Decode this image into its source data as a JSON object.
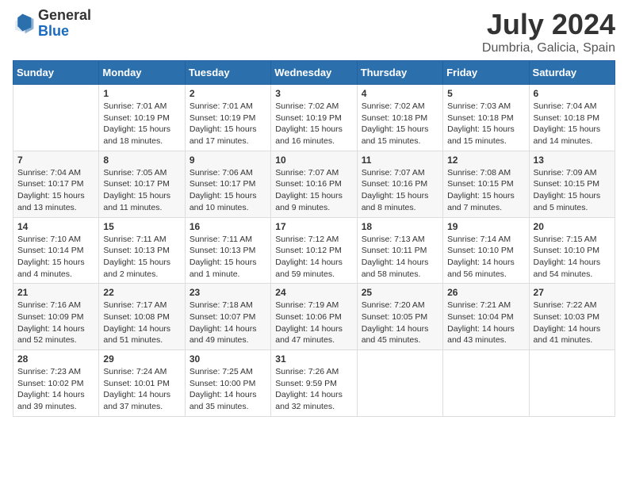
{
  "header": {
    "logo_general": "General",
    "logo_blue": "Blue",
    "month_title": "July 2024",
    "subtitle": "Dumbria, Galicia, Spain"
  },
  "weekdays": [
    "Sunday",
    "Monday",
    "Tuesday",
    "Wednesday",
    "Thursday",
    "Friday",
    "Saturday"
  ],
  "weeks": [
    [
      {
        "day": "",
        "sunrise": "",
        "sunset": "",
        "daylight": ""
      },
      {
        "day": "1",
        "sunrise": "Sunrise: 7:01 AM",
        "sunset": "Sunset: 10:19 PM",
        "daylight": "Daylight: 15 hours and 18 minutes."
      },
      {
        "day": "2",
        "sunrise": "Sunrise: 7:01 AM",
        "sunset": "Sunset: 10:19 PM",
        "daylight": "Daylight: 15 hours and 17 minutes."
      },
      {
        "day": "3",
        "sunrise": "Sunrise: 7:02 AM",
        "sunset": "Sunset: 10:19 PM",
        "daylight": "Daylight: 15 hours and 16 minutes."
      },
      {
        "day": "4",
        "sunrise": "Sunrise: 7:02 AM",
        "sunset": "Sunset: 10:18 PM",
        "daylight": "Daylight: 15 hours and 15 minutes."
      },
      {
        "day": "5",
        "sunrise": "Sunrise: 7:03 AM",
        "sunset": "Sunset: 10:18 PM",
        "daylight": "Daylight: 15 hours and 15 minutes."
      },
      {
        "day": "6",
        "sunrise": "Sunrise: 7:04 AM",
        "sunset": "Sunset: 10:18 PM",
        "daylight": "Daylight: 15 hours and 14 minutes."
      }
    ],
    [
      {
        "day": "7",
        "sunrise": "Sunrise: 7:04 AM",
        "sunset": "Sunset: 10:17 PM",
        "daylight": "Daylight: 15 hours and 13 minutes."
      },
      {
        "day": "8",
        "sunrise": "Sunrise: 7:05 AM",
        "sunset": "Sunset: 10:17 PM",
        "daylight": "Daylight: 15 hours and 11 minutes."
      },
      {
        "day": "9",
        "sunrise": "Sunrise: 7:06 AM",
        "sunset": "Sunset: 10:17 PM",
        "daylight": "Daylight: 15 hours and 10 minutes."
      },
      {
        "day": "10",
        "sunrise": "Sunrise: 7:07 AM",
        "sunset": "Sunset: 10:16 PM",
        "daylight": "Daylight: 15 hours and 9 minutes."
      },
      {
        "day": "11",
        "sunrise": "Sunrise: 7:07 AM",
        "sunset": "Sunset: 10:16 PM",
        "daylight": "Daylight: 15 hours and 8 minutes."
      },
      {
        "day": "12",
        "sunrise": "Sunrise: 7:08 AM",
        "sunset": "Sunset: 10:15 PM",
        "daylight": "Daylight: 15 hours and 7 minutes."
      },
      {
        "day": "13",
        "sunrise": "Sunrise: 7:09 AM",
        "sunset": "Sunset: 10:15 PM",
        "daylight": "Daylight: 15 hours and 5 minutes."
      }
    ],
    [
      {
        "day": "14",
        "sunrise": "Sunrise: 7:10 AM",
        "sunset": "Sunset: 10:14 PM",
        "daylight": "Daylight: 15 hours and 4 minutes."
      },
      {
        "day": "15",
        "sunrise": "Sunrise: 7:11 AM",
        "sunset": "Sunset: 10:13 PM",
        "daylight": "Daylight: 15 hours and 2 minutes."
      },
      {
        "day": "16",
        "sunrise": "Sunrise: 7:11 AM",
        "sunset": "Sunset: 10:13 PM",
        "daylight": "Daylight: 15 hours and 1 minute."
      },
      {
        "day": "17",
        "sunrise": "Sunrise: 7:12 AM",
        "sunset": "Sunset: 10:12 PM",
        "daylight": "Daylight: 14 hours and 59 minutes."
      },
      {
        "day": "18",
        "sunrise": "Sunrise: 7:13 AM",
        "sunset": "Sunset: 10:11 PM",
        "daylight": "Daylight: 14 hours and 58 minutes."
      },
      {
        "day": "19",
        "sunrise": "Sunrise: 7:14 AM",
        "sunset": "Sunset: 10:10 PM",
        "daylight": "Daylight: 14 hours and 56 minutes."
      },
      {
        "day": "20",
        "sunrise": "Sunrise: 7:15 AM",
        "sunset": "Sunset: 10:10 PM",
        "daylight": "Daylight: 14 hours and 54 minutes."
      }
    ],
    [
      {
        "day": "21",
        "sunrise": "Sunrise: 7:16 AM",
        "sunset": "Sunset: 10:09 PM",
        "daylight": "Daylight: 14 hours and 52 minutes."
      },
      {
        "day": "22",
        "sunrise": "Sunrise: 7:17 AM",
        "sunset": "Sunset: 10:08 PM",
        "daylight": "Daylight: 14 hours and 51 minutes."
      },
      {
        "day": "23",
        "sunrise": "Sunrise: 7:18 AM",
        "sunset": "Sunset: 10:07 PM",
        "daylight": "Daylight: 14 hours and 49 minutes."
      },
      {
        "day": "24",
        "sunrise": "Sunrise: 7:19 AM",
        "sunset": "Sunset: 10:06 PM",
        "daylight": "Daylight: 14 hours and 47 minutes."
      },
      {
        "day": "25",
        "sunrise": "Sunrise: 7:20 AM",
        "sunset": "Sunset: 10:05 PM",
        "daylight": "Daylight: 14 hours and 45 minutes."
      },
      {
        "day": "26",
        "sunrise": "Sunrise: 7:21 AM",
        "sunset": "Sunset: 10:04 PM",
        "daylight": "Daylight: 14 hours and 43 minutes."
      },
      {
        "day": "27",
        "sunrise": "Sunrise: 7:22 AM",
        "sunset": "Sunset: 10:03 PM",
        "daylight": "Daylight: 14 hours and 41 minutes."
      }
    ],
    [
      {
        "day": "28",
        "sunrise": "Sunrise: 7:23 AM",
        "sunset": "Sunset: 10:02 PM",
        "daylight": "Daylight: 14 hours and 39 minutes."
      },
      {
        "day": "29",
        "sunrise": "Sunrise: 7:24 AM",
        "sunset": "Sunset: 10:01 PM",
        "daylight": "Daylight: 14 hours and 37 minutes."
      },
      {
        "day": "30",
        "sunrise": "Sunrise: 7:25 AM",
        "sunset": "Sunset: 10:00 PM",
        "daylight": "Daylight: 14 hours and 35 minutes."
      },
      {
        "day": "31",
        "sunrise": "Sunrise: 7:26 AM",
        "sunset": "Sunset: 9:59 PM",
        "daylight": "Daylight: 14 hours and 32 minutes."
      },
      {
        "day": "",
        "sunrise": "",
        "sunset": "",
        "daylight": ""
      },
      {
        "day": "",
        "sunrise": "",
        "sunset": "",
        "daylight": ""
      },
      {
        "day": "",
        "sunrise": "",
        "sunset": "",
        "daylight": ""
      }
    ]
  ]
}
